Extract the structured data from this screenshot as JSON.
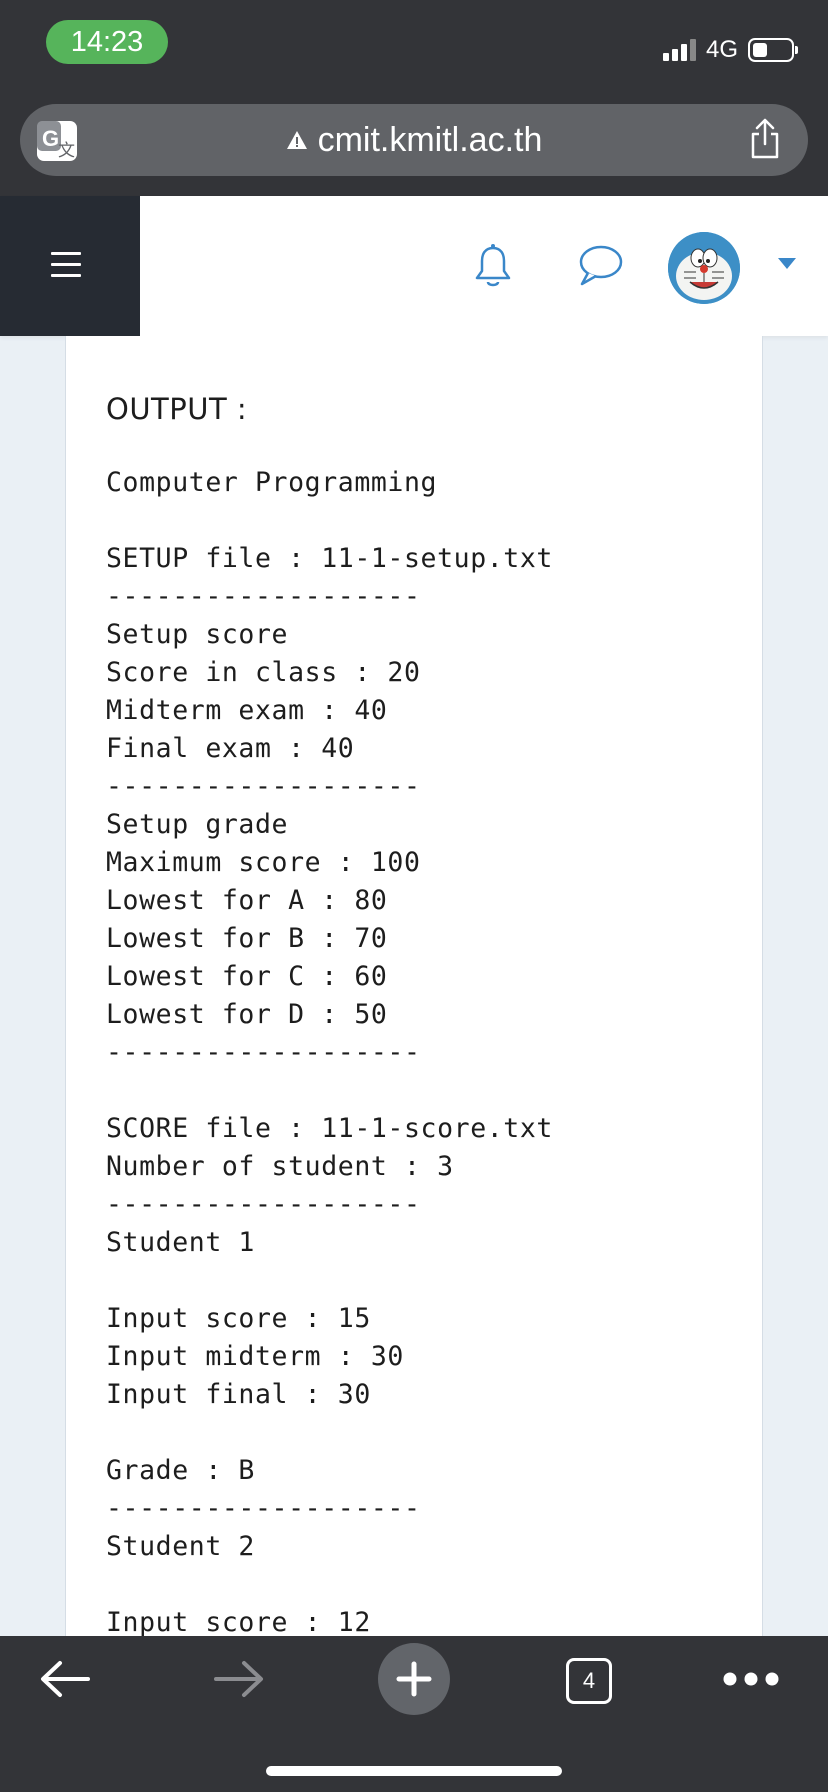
{
  "status_bar": {
    "time": "14:23",
    "network": "4G"
  },
  "browser": {
    "url": "cmit.kmitl.ac.th",
    "tab_count": "4"
  },
  "icons": {
    "translate": "translate-icon",
    "warning": "warning-icon",
    "share": "share-icon",
    "menu": "hamburger-menu-icon",
    "notifications": "bell-icon",
    "messages": "chat-bubble-icon",
    "user_menu": "caret-down-icon",
    "back": "back-arrow-icon",
    "forward": "forward-arrow-icon",
    "new_tab": "plus-icon",
    "more": "more-dots-icon"
  },
  "colors": {
    "time_pill": "#56b45b",
    "header_icons": "#3a87c9",
    "chrome": "#333438"
  },
  "content": {
    "heading": "OUTPUT :",
    "lines": [
      "Computer Programming",
      "",
      "SETUP file : 11-1-setup.txt",
      "-------------------",
      "Setup score",
      "Score in class : 20",
      "Midterm exam : 40",
      "Final exam : 40",
      "-------------------",
      "Setup grade",
      "Maximum score : 100",
      "Lowest for A : 80",
      "Lowest for B : 70",
      "Lowest for C : 60",
      "Lowest for D : 50",
      "-------------------",
      "",
      "SCORE file : 11-1-score.txt",
      "Number of student : 3",
      "-------------------",
      "Student 1",
      "",
      "Input score : 15",
      "Input midterm : 30",
      "Input final : 30",
      "",
      "Grade : B",
      "-------------------",
      "Student 2",
      "",
      "Input score : 12"
    ]
  }
}
